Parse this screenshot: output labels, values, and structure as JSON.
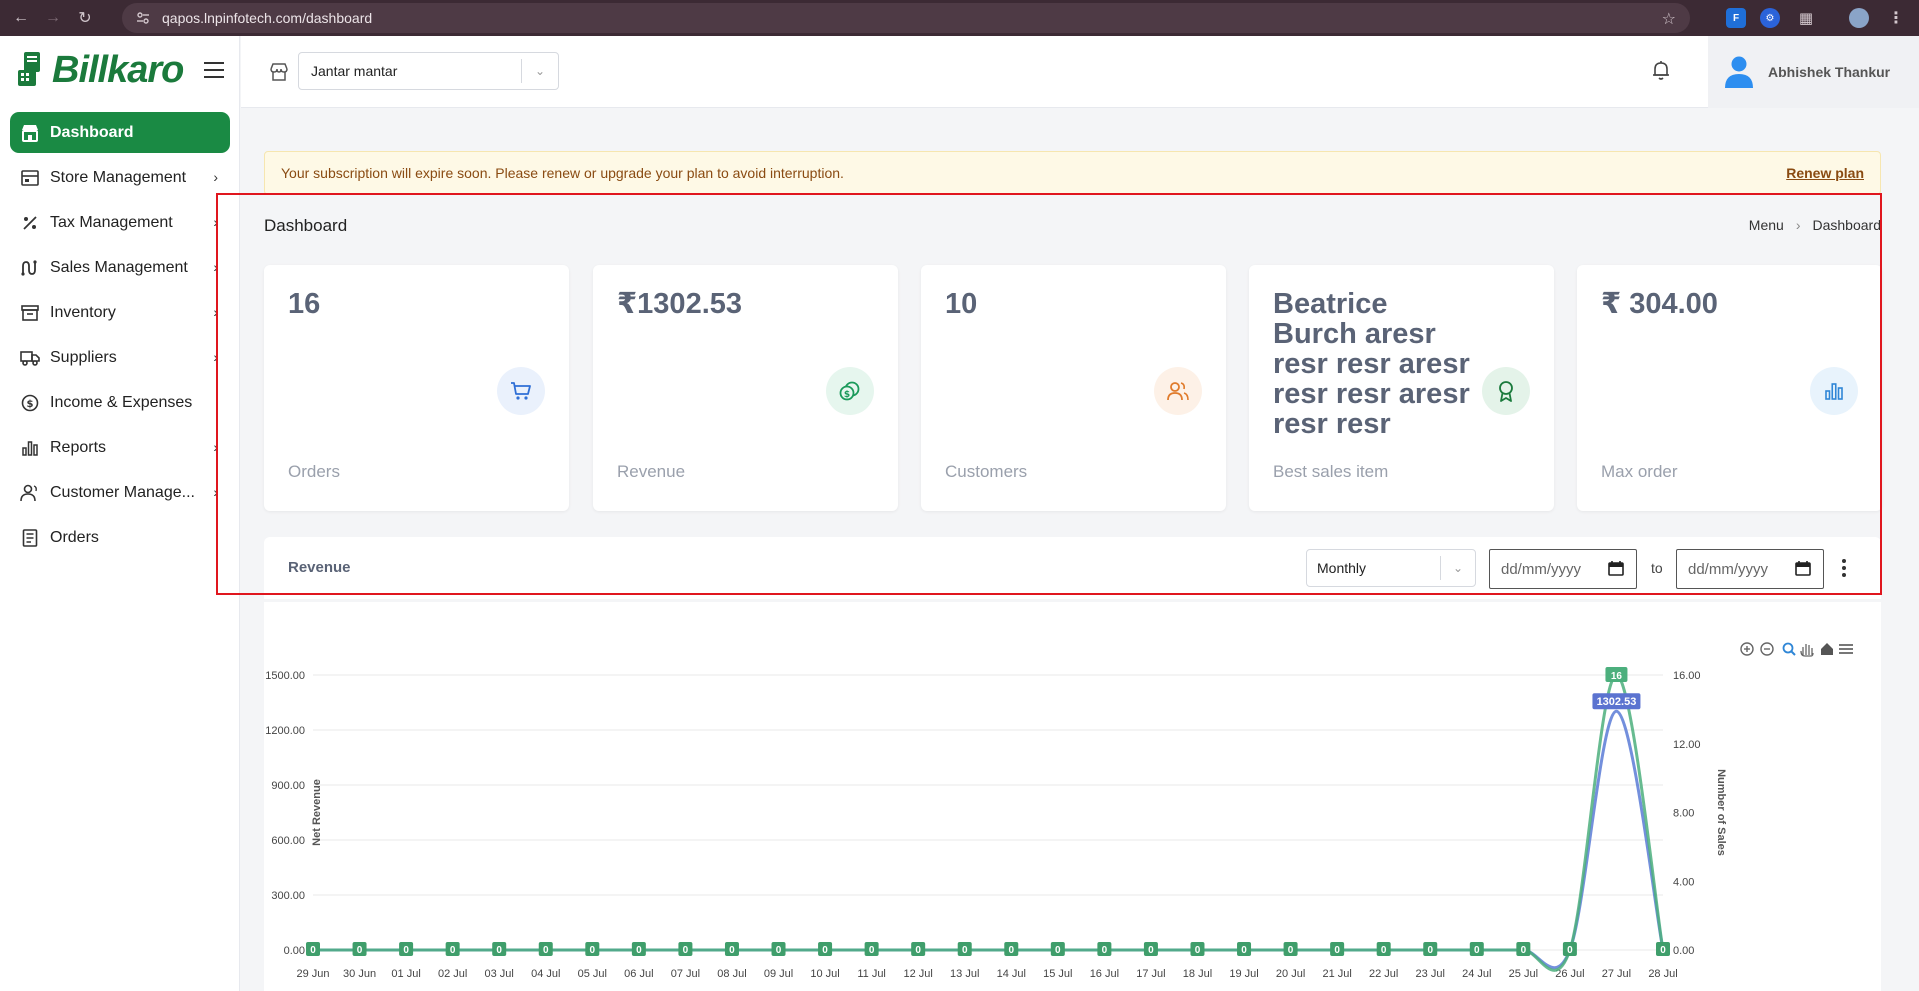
{
  "browser": {
    "url": "qapos.lnpinfotech.com/dashboard"
  },
  "app": {
    "logo_text": "Billkaro"
  },
  "sidebar": {
    "items": [
      {
        "label": "Dashboard",
        "icon": "store-icon",
        "active": true,
        "has_children": false
      },
      {
        "label": "Store Management",
        "icon": "store-management-icon",
        "active": false,
        "has_children": true
      },
      {
        "label": "Tax Management",
        "icon": "percent-icon",
        "active": false,
        "has_children": true
      },
      {
        "label": "Sales Management",
        "icon": "sales-icon",
        "active": false,
        "has_children": true
      },
      {
        "label": "Inventory",
        "icon": "inventory-icon",
        "active": false,
        "has_children": true
      },
      {
        "label": "Suppliers",
        "icon": "truck-icon",
        "active": false,
        "has_children": true
      },
      {
        "label": "Income & Expenses",
        "icon": "money-icon",
        "active": false,
        "has_children": false
      },
      {
        "label": "Reports",
        "icon": "bar-chart-icon",
        "active": false,
        "has_children": true
      },
      {
        "label": "Customer Manage...",
        "icon": "users-icon",
        "active": false,
        "has_children": true
      },
      {
        "label": "Orders",
        "icon": "orders-icon",
        "active": false,
        "has_children": false
      }
    ]
  },
  "header": {
    "store_selected": "Jantar mantar",
    "user_name": "Abhishek Thankur"
  },
  "alert": {
    "message": "Your subscription will expire soon. Please renew or upgrade your plan to avoid interruption.",
    "action": "Renew plan"
  },
  "page": {
    "title": "Dashboard",
    "breadcrumb": [
      "Menu",
      "Dashboard"
    ]
  },
  "stats": [
    {
      "value": "16",
      "label": "Orders",
      "icon": "cart-icon",
      "icon_color": "#2f6fd6",
      "icon_bg": "#eaf1fc"
    },
    {
      "value": "₹1302.53",
      "label": "Revenue",
      "icon": "coins-icon",
      "icon_color": "#1a9a5a",
      "icon_bg": "#e6f6ee"
    },
    {
      "value": "10",
      "label": "Customers",
      "icon": "customers-icon",
      "icon_color": "#e07b2c",
      "icon_bg": "#fdf1e7"
    },
    {
      "value": "Beatrice Burch aresr resr resr aresr resr resr aresr resr resr",
      "label": "Best sales item",
      "icon": "award-icon",
      "icon_color": "#1a7a3c",
      "icon_bg": "#e4f3e9"
    },
    {
      "value": "₹ 304.00",
      "label": "Max order",
      "icon": "bar-chart-icon",
      "icon_color": "#2f86d6",
      "icon_bg": "#e8f3fc"
    }
  ],
  "revenue": {
    "title": "Revenue",
    "period": "Monthly",
    "date_from_placeholder": "dd/mm/yyyy",
    "date_to_placeholder": "dd/mm/yyyy",
    "to_label": "to"
  },
  "chart_data": {
    "type": "line",
    "categories": [
      "29 Jun",
      "30 Jun",
      "01 Jul",
      "02 Jul",
      "03 Jul",
      "04 Jul",
      "05 Jul",
      "06 Jul",
      "07 Jul",
      "08 Jul",
      "09 Jul",
      "10 Jul",
      "11 Jul",
      "12 Jul",
      "13 Jul",
      "14 Jul",
      "15 Jul",
      "16 Jul",
      "17 Jul",
      "18 Jul",
      "19 Jul",
      "20 Jul",
      "21 Jul",
      "22 Jul",
      "23 Jul",
      "24 Jul",
      "25 Jul",
      "26 Jul",
      "27 Jul",
      "28 Jul"
    ],
    "series": [
      {
        "axis": "left",
        "color": "#5b7bd6",
        "values": [
          0,
          0,
          0,
          0,
          0,
          0,
          0,
          0,
          0,
          0,
          0,
          0,
          0,
          0,
          0,
          0,
          0,
          0,
          0,
          0,
          0,
          0,
          0,
          0,
          0,
          0,
          0,
          0,
          1302.53,
          0
        ]
      },
      {
        "axis": "right",
        "color": "#4caf7d",
        "values": [
          0,
          0,
          0,
          0,
          0,
          0,
          0,
          0,
          0,
          0,
          0,
          0,
          0,
          0,
          0,
          0,
          0,
          0,
          0,
          0,
          0,
          0,
          0,
          0,
          0,
          0,
          0,
          0,
          16,
          0
        ]
      }
    ],
    "ylabel": "Net Revenue",
    "y2label": "Number of Sales",
    "ylim": [
      0,
      1500
    ],
    "y2lim": [
      0,
      16
    ],
    "yticks": [
      "0.00",
      "300.00",
      "600.00",
      "900.00",
      "1200.00",
      "1500.00"
    ],
    "y2ticks": [
      "0.00",
      "4.00",
      "8.00",
      "12.00",
      "16.00"
    ],
    "data_labels": {
      "revenue_peak": "1302.53",
      "sales_peak": "16",
      "zero": "0"
    },
    "toolbar_icons": [
      "zoom-in-icon",
      "zoom-out-icon",
      "zoom-select-icon",
      "pan-icon",
      "reset-home-icon",
      "menu-icon"
    ],
    "grid": true
  }
}
